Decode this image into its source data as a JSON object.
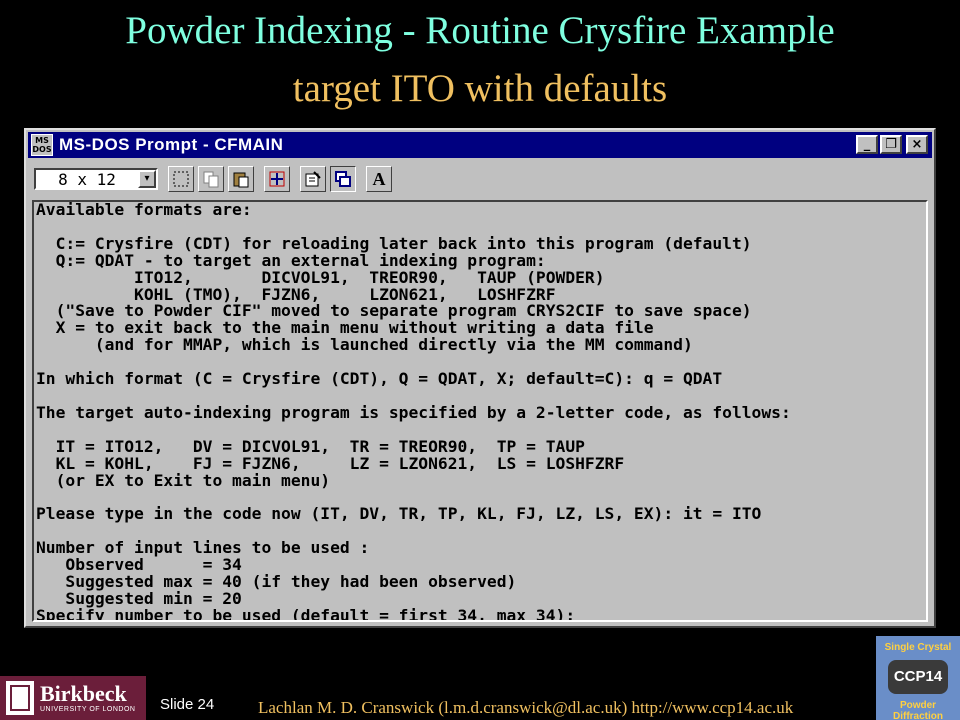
{
  "slide": {
    "title_line1": "Powder Indexing - Routine Crysfire Example",
    "title_line2": "target ITO with defaults",
    "slide_number": "Slide 24",
    "author": "Lachlan M. D. Cranswick (l.m.d.cranswick@dl.ac.uk) http://www.ccp14.ac.uk",
    "logo_main": "Birkbeck",
    "logo_sub": "UNIVERSITY OF LONDON",
    "ccp14_top": "Single Crystal",
    "ccp14_mid": "CCP14",
    "ccp14_bottom": "Powder Diffraction"
  },
  "window": {
    "icon_text_top": "MS",
    "icon_text_bottom": "DOS",
    "title": "MS-DOS Prompt - CFMAIN",
    "buttons": {
      "minimize": "_",
      "maximize": "❐",
      "close": "×"
    }
  },
  "toolbar": {
    "font_size": "8 x 12",
    "dropdown_arrow": "▾",
    "font_button": "A"
  },
  "console": {
    "lines": [
      "Available formats are:",
      "",
      "  C:= Crysfire (CDT) for reloading later back into this program (default)",
      "  Q:= QDAT - to target an external indexing program:",
      "          ITO12,       DICVOL91,  TREOR90,   TAUP (POWDER)",
      "          KOHL (TMO),  FJZN6,     LZON621,   LOSHFZRF",
      "  (\"Save to Powder CIF\" moved to separate program CRYS2CIF to save space)",
      "  X = to exit back to the main menu without writing a data file",
      "      (and for MMAP, which is launched directly via the MM command)",
      "",
      "In which format (C = Crysfire (CDT), Q = QDAT, X; default=C): q = QDAT",
      "",
      "The target auto-indexing program is specified by a 2-letter code, as follows:",
      "",
      "  IT = ITO12,   DV = DICVOL91,  TR = TREOR90,  TP = TAUP",
      "  KL = KOHL,    FJ = FJZN6,     LZ = LZON621,  LS = LOSHFZRF",
      "  (or EX to Exit to main menu)",
      "",
      "Please type in the code now (IT, DV, TR, TP, KL, FJ, LZ, LS, EX): it = ITO",
      "",
      "Number of input lines to be used :",
      "   Observed      = 34",
      "   Suggested max = 40 (if they had been observed)",
      "   Suggested min = 20",
      "Specify number to be used (default = first 34, max 34):"
    ]
  }
}
